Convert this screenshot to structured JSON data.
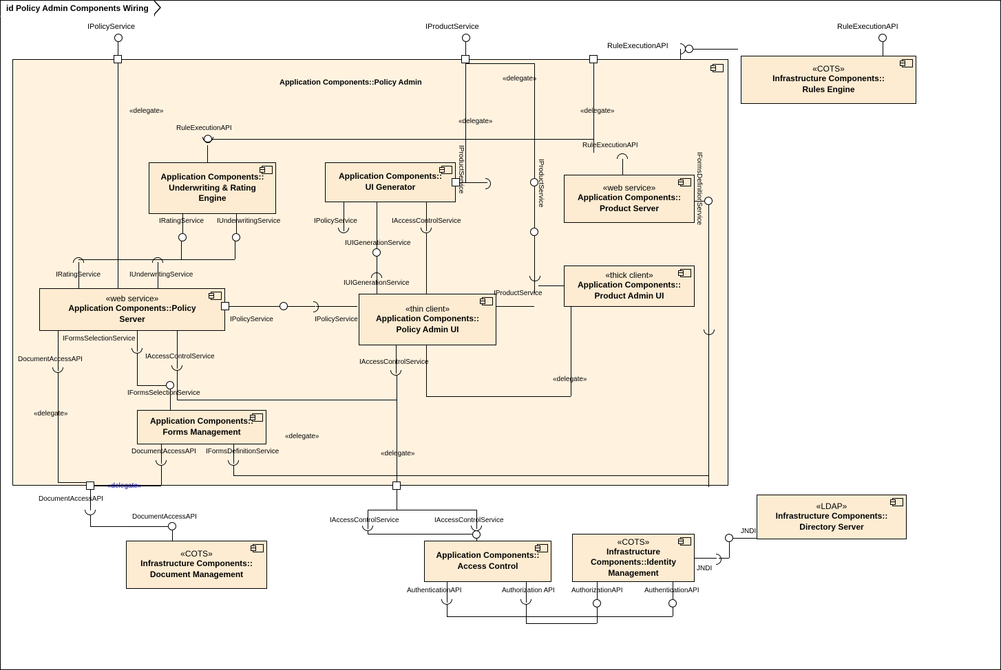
{
  "title": "id Policy Admin Components Wiring",
  "frame_title": "Application Components::Policy Admin",
  "components": {
    "underwriting": {
      "stereotype": "",
      "name": "Application Components::\nUnderwriting & Rating\nEngine"
    },
    "ui_gen": {
      "stereotype": "",
      "name": "Application Components::\nUI Generator"
    },
    "product_server": {
      "stereotype": "«web service»",
      "name": "Application Components::\nProduct Server"
    },
    "policy_server": {
      "stereotype": "«web service»",
      "name": "Application Components::Policy\nServer"
    },
    "policy_admin_ui": {
      "stereotype": "«thin client»",
      "name": "Application Components::\nPolicy Admin UI"
    },
    "product_admin_ui": {
      "stereotype": "«thick client»",
      "name": "Application Components::\nProduct Admin UI"
    },
    "forms_mgmt": {
      "stereotype": "",
      "name": "Application Components::\nForms Management"
    },
    "rules_engine": {
      "stereotype": "«COTS»",
      "name": "Infrastructure Components::\nRules Engine"
    },
    "doc_mgmt": {
      "stereotype": "«COTS»",
      "name": "Infrastructure Components::\nDocument Management"
    },
    "access_control": {
      "stereotype": "",
      "name": "Application Components::\nAccess Control"
    },
    "identity_mgmt": {
      "stereotype": "«COTS»",
      "name": "Infrastructure Components::Identity Management"
    },
    "directory_server": {
      "stereotype": "«LDAP»",
      "name": "Infrastructure Components::\nDirectory Server"
    }
  },
  "labels": {
    "ipolicy": "IPolicyService",
    "iproduct": "IProductService",
    "ruleexec": "RuleExecutionAPI",
    "delegate": "«delegate»",
    "irating": "IRatingService",
    "iunderwriting": "IUnderwritingService",
    "iuigen": "IUIGenerationService",
    "iaccess": "IAccessControlService",
    "iproduct_v": "IProductService",
    "iformsdef": "IFormsDefinitionService",
    "iformssel": "IFormsSelectionService",
    "docaccess": "DocumentAccessAPI",
    "authapi": "AuthenticationAPI",
    "authzapi": "AuthorizationAPI",
    "authz_space": "Authorization API",
    "jndi": "JNDI"
  }
}
